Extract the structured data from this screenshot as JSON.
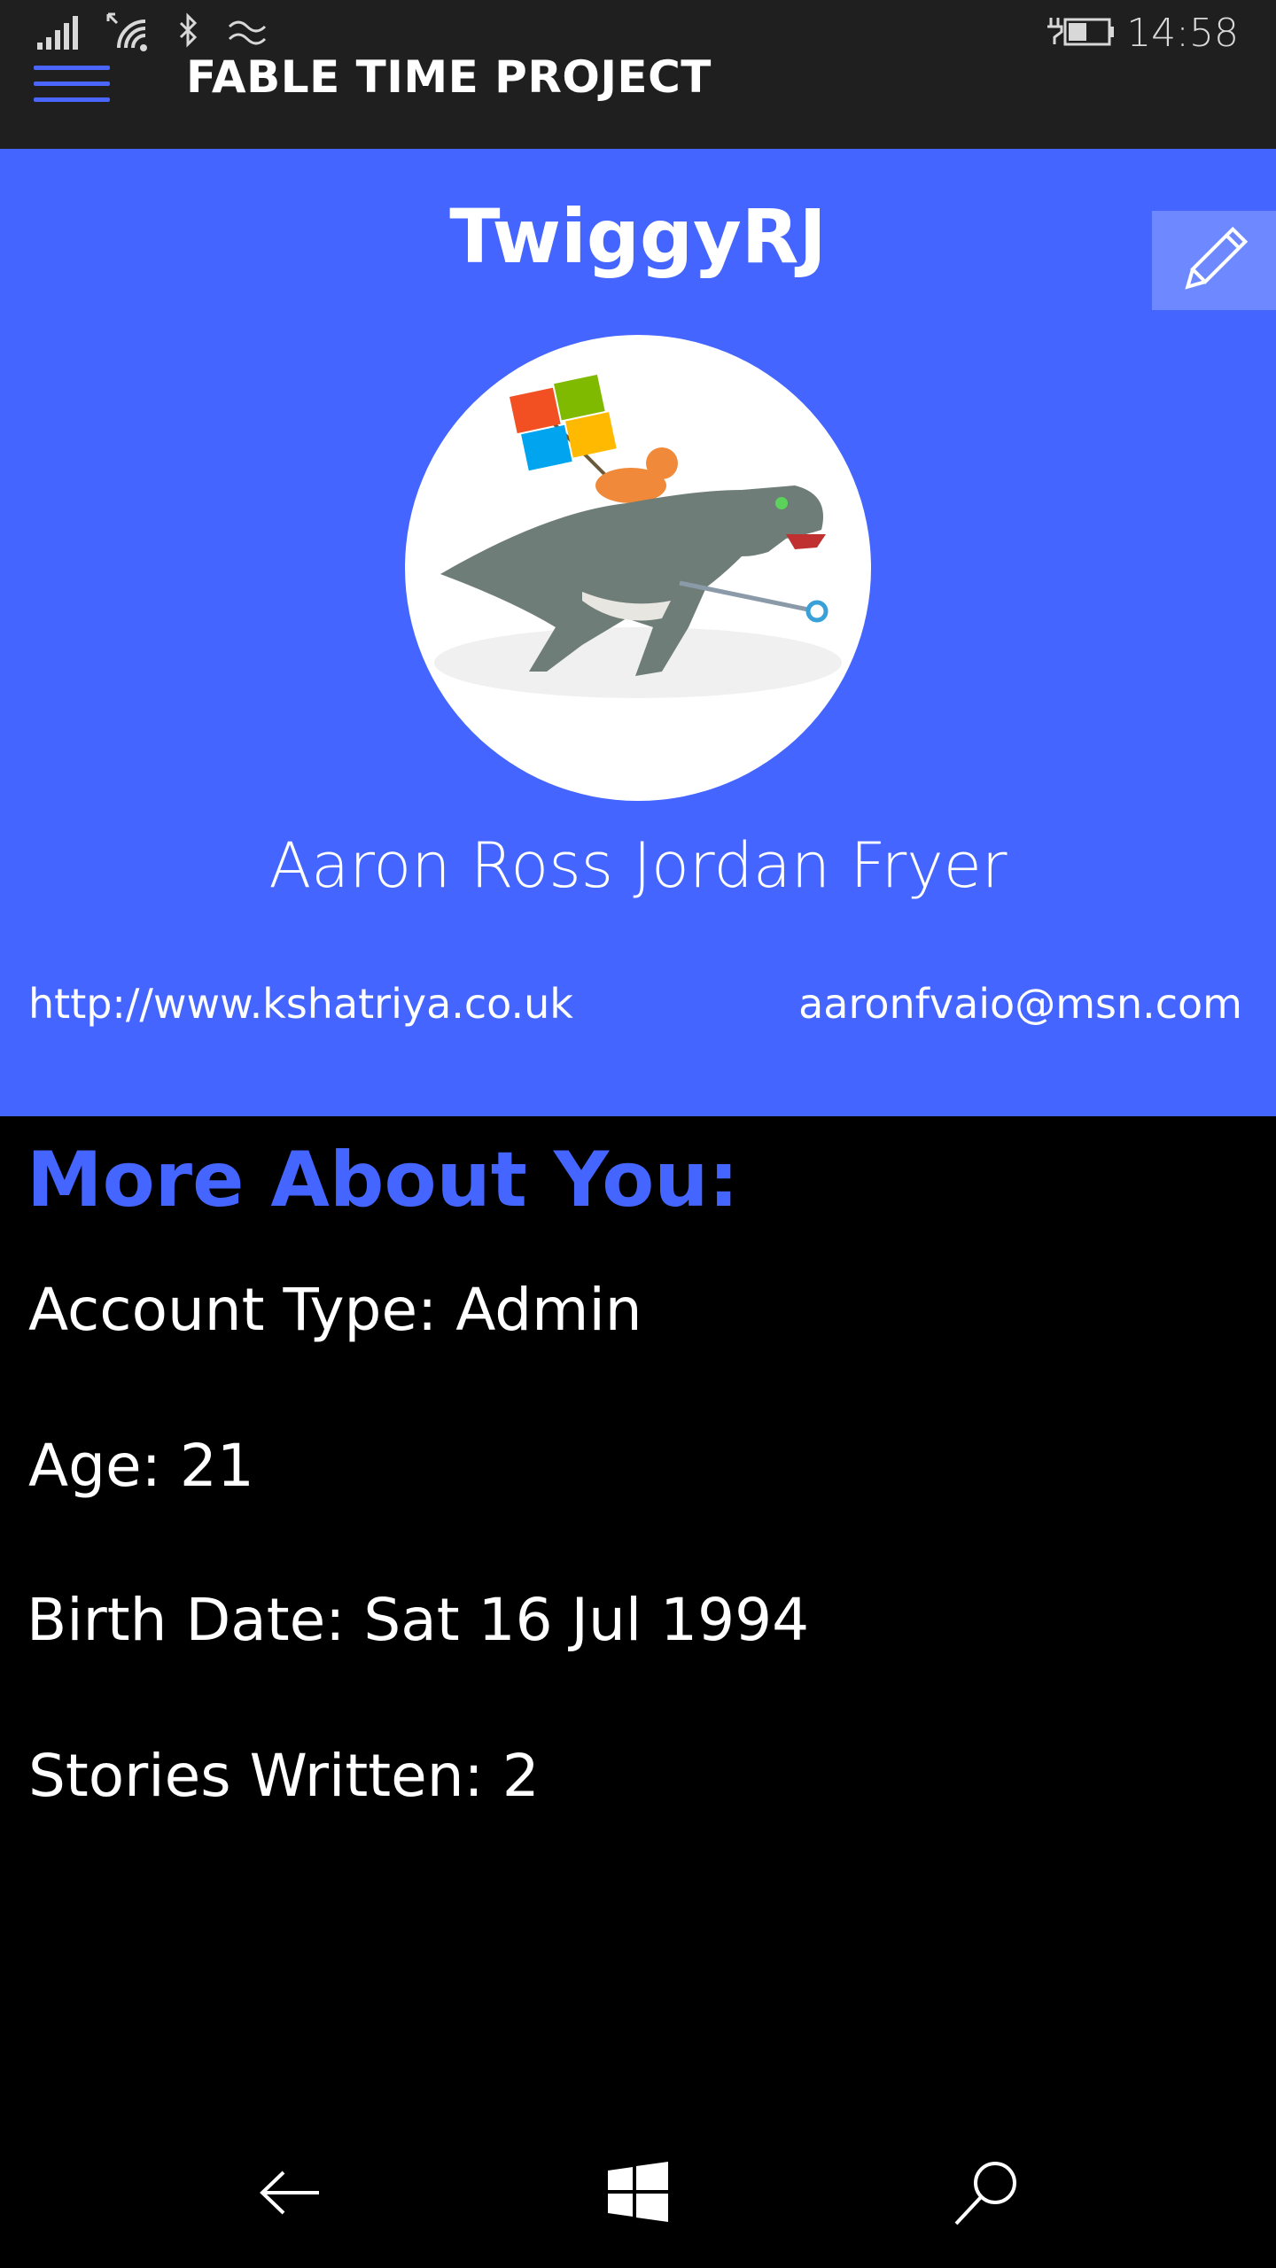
{
  "status_bar": {
    "time": "14:58",
    "icons": [
      "signal-icon",
      "wifi-icon",
      "bluetooth-icon",
      "network-icon",
      "battery-charging-icon"
    ]
  },
  "app_bar": {
    "title": "FABLE TIME PROJECT",
    "menu_icon": "hamburger-menu-icon"
  },
  "profile": {
    "username": "TwiggyRJ",
    "full_name": "Aaron Ross Jordan Fryer",
    "website": "http://www.kshatriya.co.uk",
    "email": "aaronfvaio@msn.com",
    "edit_icon": "pencil-icon",
    "avatar_icon": "dinosaur-avatar-icon"
  },
  "details": {
    "title": "More About You:",
    "account_type": "Account Type: Admin",
    "age": "Age: 21",
    "birth_date": "Birth Date: Sat 16 Jul 1994",
    "stories_written": "Stories Written: 2"
  },
  "nav_bar": {
    "icons": [
      "back-arrow-icon",
      "windows-start-icon",
      "search-icon"
    ]
  },
  "colors": {
    "accent": "#4465ff",
    "status_bar_bg": "#1f1f1f",
    "page_bg": "#000000",
    "edit_button_bg": "#6e88ff"
  }
}
